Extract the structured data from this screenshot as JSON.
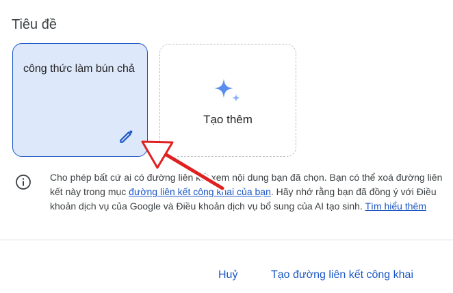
{
  "dialog": {
    "title": "Tiêu đề",
    "selected_card_text": "công thức làm bún chả",
    "add_card_label": "Tạo thêm",
    "info": {
      "text_1": "Cho phép bất cứ ai có đường liên kết xem nội dung bạn đã chọn. Bạn có thể xoá đường liên kết này trong mục ",
      "link_1": "đường liên kết công khai của bạn",
      "text_2": ". Hãy nhớ rằng bạn đã đồng ý với Điều khoản dịch vụ của Google và Điều khoản dịch vụ bổ sung của AI tạo sinh. ",
      "link_2": "Tìm hiểu thêm"
    },
    "buttons": {
      "cancel": "Huỷ",
      "create": "Tạo đường liên kết công khai"
    }
  },
  "colors": {
    "accent": "#1a56c4",
    "selected_card_bg": "#dde8fa",
    "sparkle": "#5b8def",
    "annotation_arrow": "#e02020"
  },
  "icons": {
    "edit": "pencil-icon",
    "add": "sparkle-icon",
    "info": "info-icon"
  }
}
